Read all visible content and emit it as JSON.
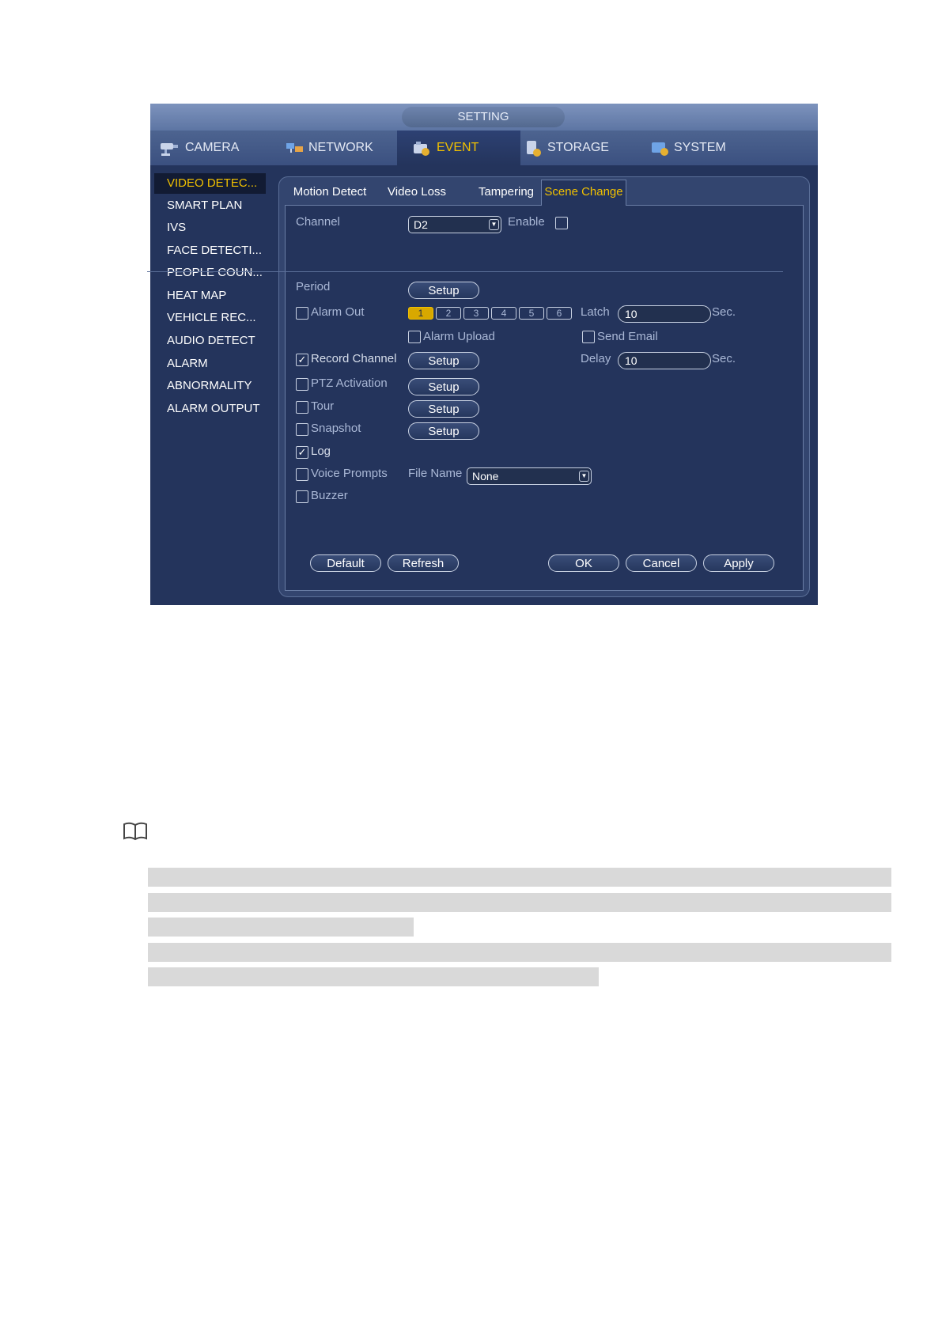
{
  "window": {
    "title": "SETTING"
  },
  "main_tabs": [
    {
      "label": "CAMERA",
      "icon": "camera-icon"
    },
    {
      "label": "NETWORK",
      "icon": "network-icon"
    },
    {
      "label": "EVENT",
      "icon": "event-icon",
      "active": true
    },
    {
      "label": "STORAGE",
      "icon": "storage-icon"
    },
    {
      "label": "SYSTEM",
      "icon": "system-icon"
    }
  ],
  "sidebar": {
    "items": [
      {
        "label": "VIDEO DETEC...",
        "active": true
      },
      {
        "label": "SMART PLAN"
      },
      {
        "label": "IVS"
      },
      {
        "label": "FACE DETECTI..."
      },
      {
        "label": "PEOPLE COUN..."
      },
      {
        "label": "HEAT MAP"
      },
      {
        "label": "VEHICLE REC..."
      },
      {
        "label": "AUDIO DETECT"
      },
      {
        "label": "ALARM"
      },
      {
        "label": "ABNORMALITY"
      },
      {
        "label": "ALARM OUTPUT"
      }
    ]
  },
  "sub_tabs": [
    {
      "label": "Motion Detect"
    },
    {
      "label": "Video Loss"
    },
    {
      "label": "Tampering"
    },
    {
      "label": "Scene Change",
      "active": true
    }
  ],
  "form": {
    "channel_label": "Channel",
    "channel_value": "D2",
    "enable_label": "Enable",
    "enable_checked": false,
    "period_label": "Period",
    "setup_label": "Setup",
    "alarm_out_label": "Alarm Out",
    "alarm_out_checked": false,
    "alarm_out_channels": [
      "1",
      "2",
      "3",
      "4",
      "5",
      "6"
    ],
    "alarm_out_selected": "1",
    "latch_label": "Latch",
    "latch_value": "10",
    "sec_label": "Sec.",
    "alarm_upload_label": "Alarm Upload",
    "send_email_label": "Send Email",
    "record_channel_label": "Record Channel",
    "record_channel_checked": true,
    "delay_label": "Delay",
    "delay_value": "10",
    "ptz_activation_label": "PTZ Activation",
    "tour_label": "Tour",
    "snapshot_label": "Snapshot",
    "log_label": "Log",
    "log_checked": true,
    "voice_prompts_label": "Voice Prompts",
    "file_name_label": "File Name",
    "file_name_value": "None",
    "buzzer_label": "Buzzer"
  },
  "footer": {
    "default_label": "Default",
    "refresh_label": "Refresh",
    "ok_label": "OK",
    "cancel_label": "Cancel",
    "apply_label": "Apply"
  },
  "colors": {
    "accent": "#f0c000",
    "panel": "#24345c",
    "tabbar": "#3b5080"
  }
}
